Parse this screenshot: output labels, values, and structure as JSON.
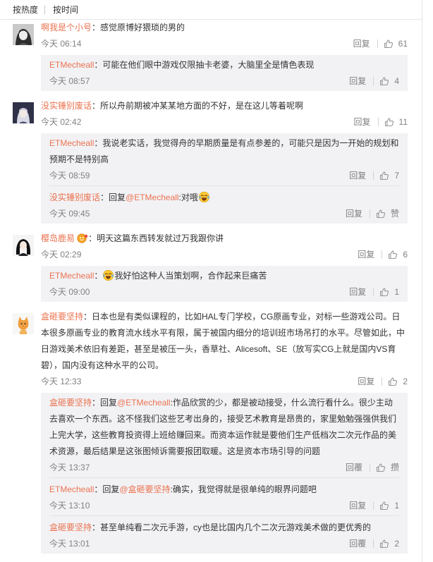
{
  "sort": {
    "hot": "按热度",
    "time": "按时间"
  },
  "colors": {
    "username": "#eb7350",
    "text": "#333333",
    "meta": "#808080",
    "reply_box": "#f2f2f5"
  },
  "comments": [
    {
      "user": "啊我是个小号",
      "text": "：感觉原博好猥琐的男的",
      "time": "今天 06:14",
      "reply_label": "回复",
      "likes": "61",
      "replies": [
        {
          "user": "ETMecheall",
          "text": "：可能在他们眼中游戏仅限抽卡老婆，大脑里全是情色表现",
          "time": "今天 08:57",
          "reply_label": "回复",
          "likes": "4"
        }
      ]
    },
    {
      "user": "没实锤别废话",
      "text": "：所以舟前期被冲某某地方面的不好，是在这儿等着呢啊",
      "time": "今天 02:42",
      "reply_label": "回复",
      "likes": "11",
      "replies": [
        {
          "user": "ETMecheall",
          "text": "：我说老实话，我觉得舟的早期质量是有点参差的，可能只是因为一开始的规划和预期不是特别高",
          "time": "今天 08:59",
          "reply_label": "回复",
          "likes": "7"
        },
        {
          "user": "没实锤别废话",
          "prefix": "：回复",
          "mention": "@ETMecheall",
          "text": ":对哦",
          "emoji": "laugh-cry-emoji-icon",
          "time": "今天 09:45",
          "reply_label": "回复",
          "likes": "赞"
        }
      ]
    },
    {
      "user": "樱岛鹿易",
      "badge": "user-badge-icon",
      "text": "：明天这篇东西转发就过万我跟你讲",
      "time": "今天 02:29",
      "reply_label": "回复",
      "likes": "6",
      "replies": [
        {
          "user": "ETMecheall",
          "prefix": "：",
          "emoji": "laugh-cry-emoji-icon",
          "text": "我好怕这种人当策划啊，合作起来巨痛苦",
          "time": "今天 09:00",
          "reply_label": "回复",
          "likes": "1"
        }
      ]
    },
    {
      "user": "盒砸要坚持",
      "text": "：日本也是有类似课程的，比如HAL专门学校，CG原画专业，对标一些游戏公司。日本很多原画专业的教育流水线水平有限，属于被国内细分的培训班市场吊打的水平。尽管如此，中日游戏美术依旧有差距，甚至是被压一头，香草社、Alicesoft、SE（放写实CG上就是国内VS育碧），国内没有这种水平的公司。",
      "time": "今天 12:33",
      "reply_label": "回复",
      "likes": "2",
      "replies": [
        {
          "user": "盒砸要坚持",
          "prefix": "：回复",
          "mention": "@ETMecheall",
          "text": ":作品欣赏的少，都是被动接受，什么流行看什么。很少主动去喜欢一个东西。这不怪我们这些艺考出身的，接受艺术教育是昂贵的，家里勉勉强强供我们上完大学，这些教育投资得上班给赚回来。而资本运作就是要他们生产低档次二次元作品的美术资源，最后结果是这张图倾诉需要报团取暖。这是资本市场引导的问题",
          "time": "今天 13:37",
          "reply_label": "回覆",
          "likes": "攒"
        },
        {
          "user": "ETMecheall",
          "prefix": "：回复",
          "mention": "@盒砸要坚持",
          "text": ":确实，我觉得就是很单纯的眼界问题吧",
          "time": "今天 13:10",
          "reply_label": "回复",
          "likes": "1"
        },
        {
          "user": "盒砸要坚持",
          "text": "：甚至单纯看二次元手游，cy也是比国内几个二次元游戏美术做的更优秀的",
          "time": "今天 13:01",
          "reply_label": "回覆",
          "likes": "2"
        }
      ]
    }
  ]
}
